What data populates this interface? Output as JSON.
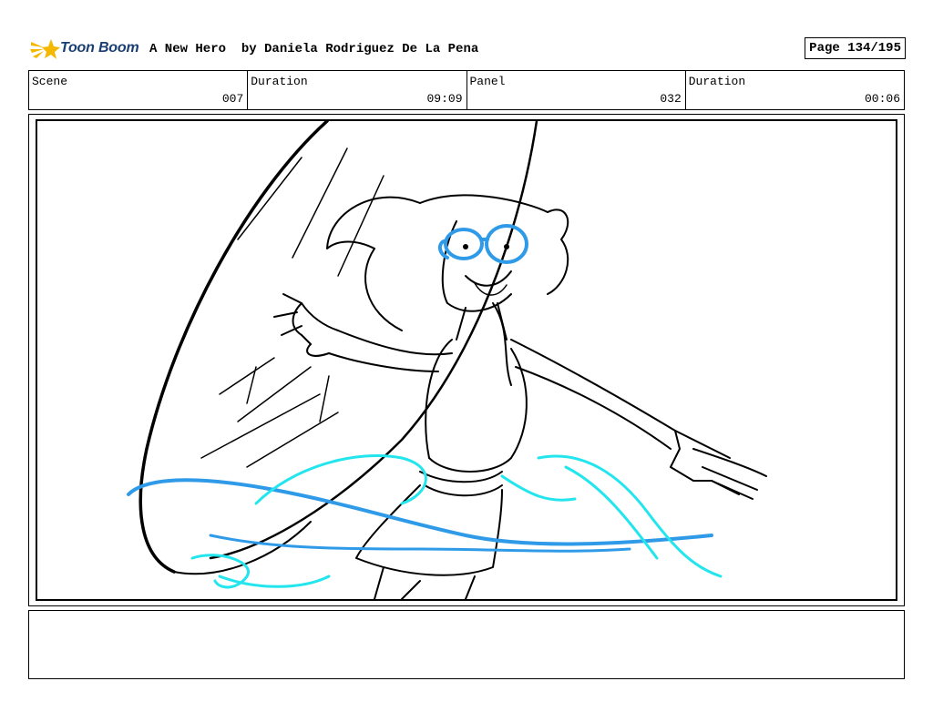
{
  "header": {
    "logo_text": "Toon Boom",
    "title": "A New Hero  by Daniela Rodriguez De La Pena",
    "page": "Page 134/195"
  },
  "info": {
    "scene_label": "Scene",
    "scene_value": "007",
    "duration1_label": "Duration",
    "duration1_value": "09:09",
    "panel_label": "Panel",
    "panel_value": "032",
    "duration2_label": "Duration",
    "duration2_value": "00:06"
  },
  "colors": {
    "logo_text": "#1b3f73",
    "logo_star": "#f5b800",
    "sketch_line": "#000000",
    "magic_blue": "#2f9be8",
    "magic_cyan": "#22e5ee"
  },
  "icons": {
    "logo": "toon-boom-star-icon"
  }
}
